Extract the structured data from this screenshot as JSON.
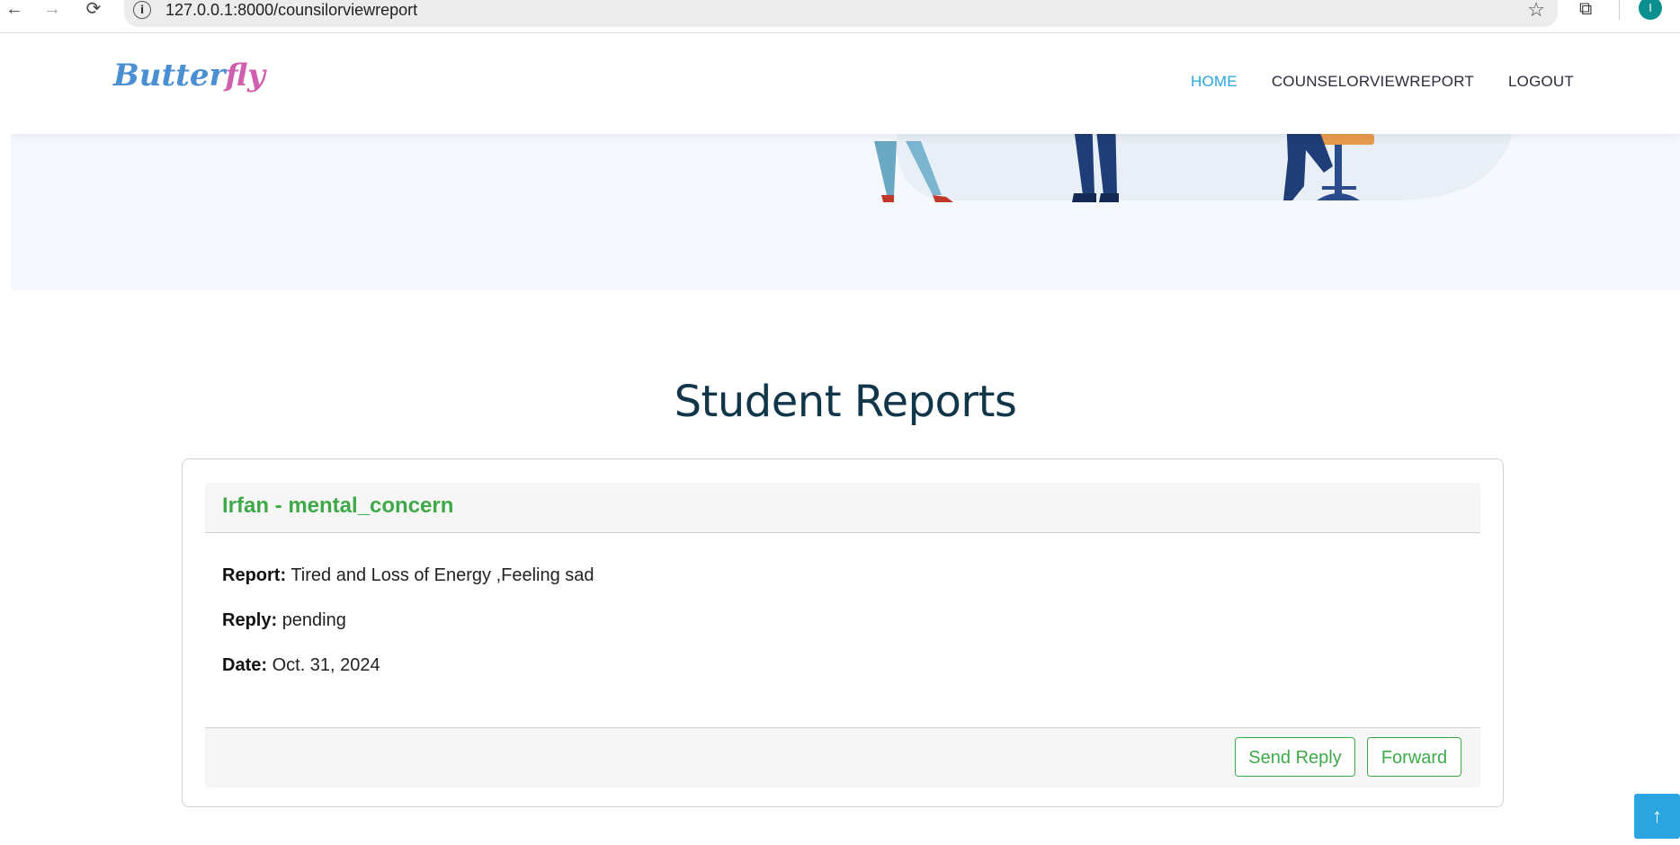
{
  "browser": {
    "url": "127.0.0.1:8000/counsilorviewreport",
    "back_icon": "←",
    "forward_icon": "→",
    "reload_icon": "⟳",
    "profile_initial": "I"
  },
  "header": {
    "logo_text": "Butterfly",
    "nav": [
      {
        "label": "HOME",
        "active": true
      },
      {
        "label": "COUNSELORVIEWREPORT",
        "active": false
      },
      {
        "label": "LOGOUT",
        "active": false
      }
    ]
  },
  "section": {
    "title": "Student Reports"
  },
  "report": {
    "title": "Irfan - mental_concern",
    "report_label": "Report:",
    "report_value": "Tired and Loss of Energy ,Feeling sad",
    "reply_label": "Reply:",
    "reply_value": "pending",
    "date_label": "Date:",
    "date_value": "Oct. 31, 2024",
    "send_reply_label": "Send Reply",
    "forward_label": "Forward"
  },
  "colors": {
    "accent": "#2aa5e0",
    "title_dark": "#11364a",
    "green": "#3fa94a"
  },
  "to_top_icon": "↑"
}
